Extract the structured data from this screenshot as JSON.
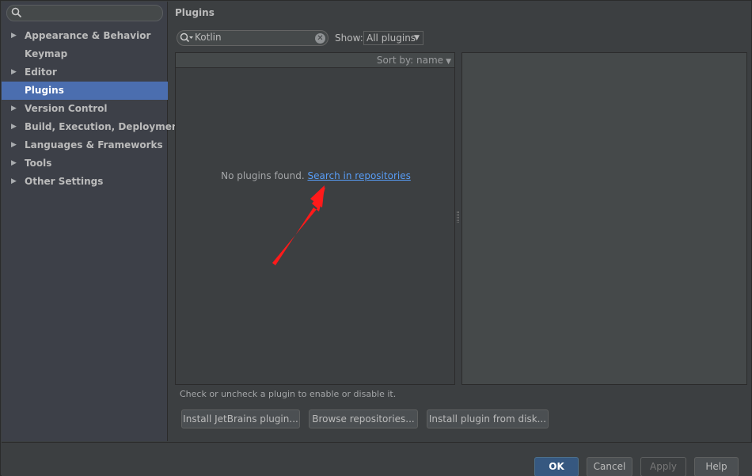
{
  "sidebar": {
    "items": [
      {
        "label": "Appearance & Behavior",
        "arrow": "▶",
        "selected": false
      },
      {
        "label": "Keymap",
        "arrow": "",
        "selected": false
      },
      {
        "label": "Editor",
        "arrow": "▶",
        "selected": false
      },
      {
        "label": "Plugins",
        "arrow": "",
        "selected": true
      },
      {
        "label": "Version Control",
        "arrow": "▶",
        "selected": false
      },
      {
        "label": "Build, Execution, Deployment",
        "arrow": "▶",
        "selected": false
      },
      {
        "label": "Languages & Frameworks",
        "arrow": "▶",
        "selected": false
      },
      {
        "label": "Tools",
        "arrow": "▶",
        "selected": false
      },
      {
        "label": "Other Settings",
        "arrow": "▶",
        "selected": false
      }
    ]
  },
  "main": {
    "title": "Plugins",
    "search_value": "Kotlin",
    "clear_glyph": "✕",
    "show_label": "Show:",
    "show_value": "All plugins",
    "sort_label": "Sort by: name",
    "empty_text": "No plugins found.",
    "empty_link": "Search in repositories",
    "hint": "Check or uncheck a plugin to enable or disable it.",
    "buttons": {
      "install_jetbrains": "Install JetBrains plugin...",
      "browse": "Browse repositories...",
      "from_disk": "Install plugin from disk..."
    }
  },
  "footer": {
    "ok": "OK",
    "cancel": "Cancel",
    "apply": "Apply",
    "help": "Help"
  },
  "colors": {
    "background": "#3c3f41",
    "sidebar": "#3d4048",
    "selection": "#4b6eaf",
    "link": "#589df6",
    "annotation_arrow": "#ff1a1a"
  }
}
